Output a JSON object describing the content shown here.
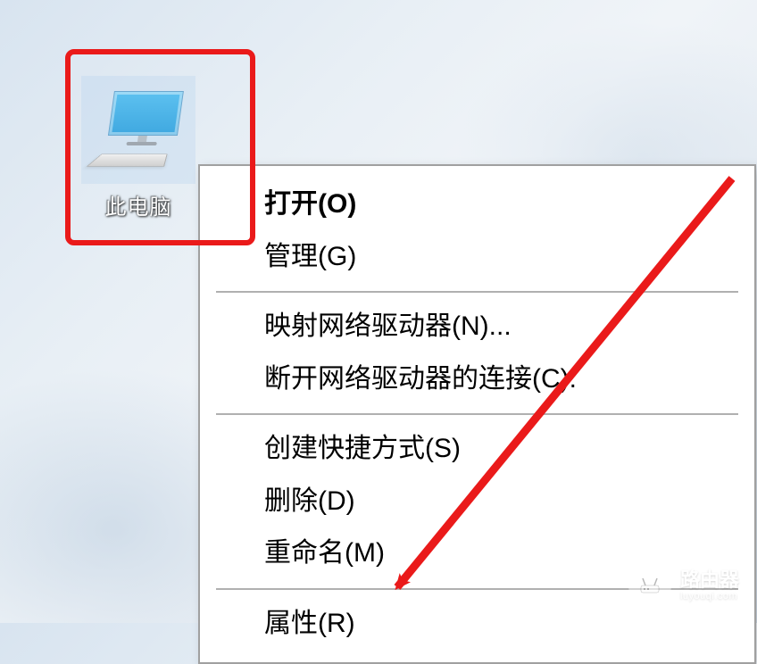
{
  "desktop_icon": {
    "label": "此电脑",
    "icon_name": "this-pc-icon"
  },
  "context_menu": {
    "sections": [
      {
        "items": [
          {
            "label": "打开(O)",
            "bold": true
          },
          {
            "label": "管理(G)",
            "bold": false
          }
        ]
      },
      {
        "items": [
          {
            "label": "映射网络驱动器(N)...",
            "bold": false
          },
          {
            "label": "断开网络驱动器的连接(C).",
            "bold": false
          }
        ]
      },
      {
        "items": [
          {
            "label": "创建快捷方式(S)",
            "bold": false
          },
          {
            "label": "删除(D)",
            "bold": false
          },
          {
            "label": "重命名(M)",
            "bold": false
          }
        ]
      },
      {
        "items": [
          {
            "label": "属性(R)",
            "bold": false
          }
        ]
      }
    ]
  },
  "annotation": {
    "highlight_color": "#ea1a1a",
    "arrow_color": "#ea1a1a"
  },
  "watermark": {
    "title": "路由器",
    "sub": "luyouqi.com"
  }
}
